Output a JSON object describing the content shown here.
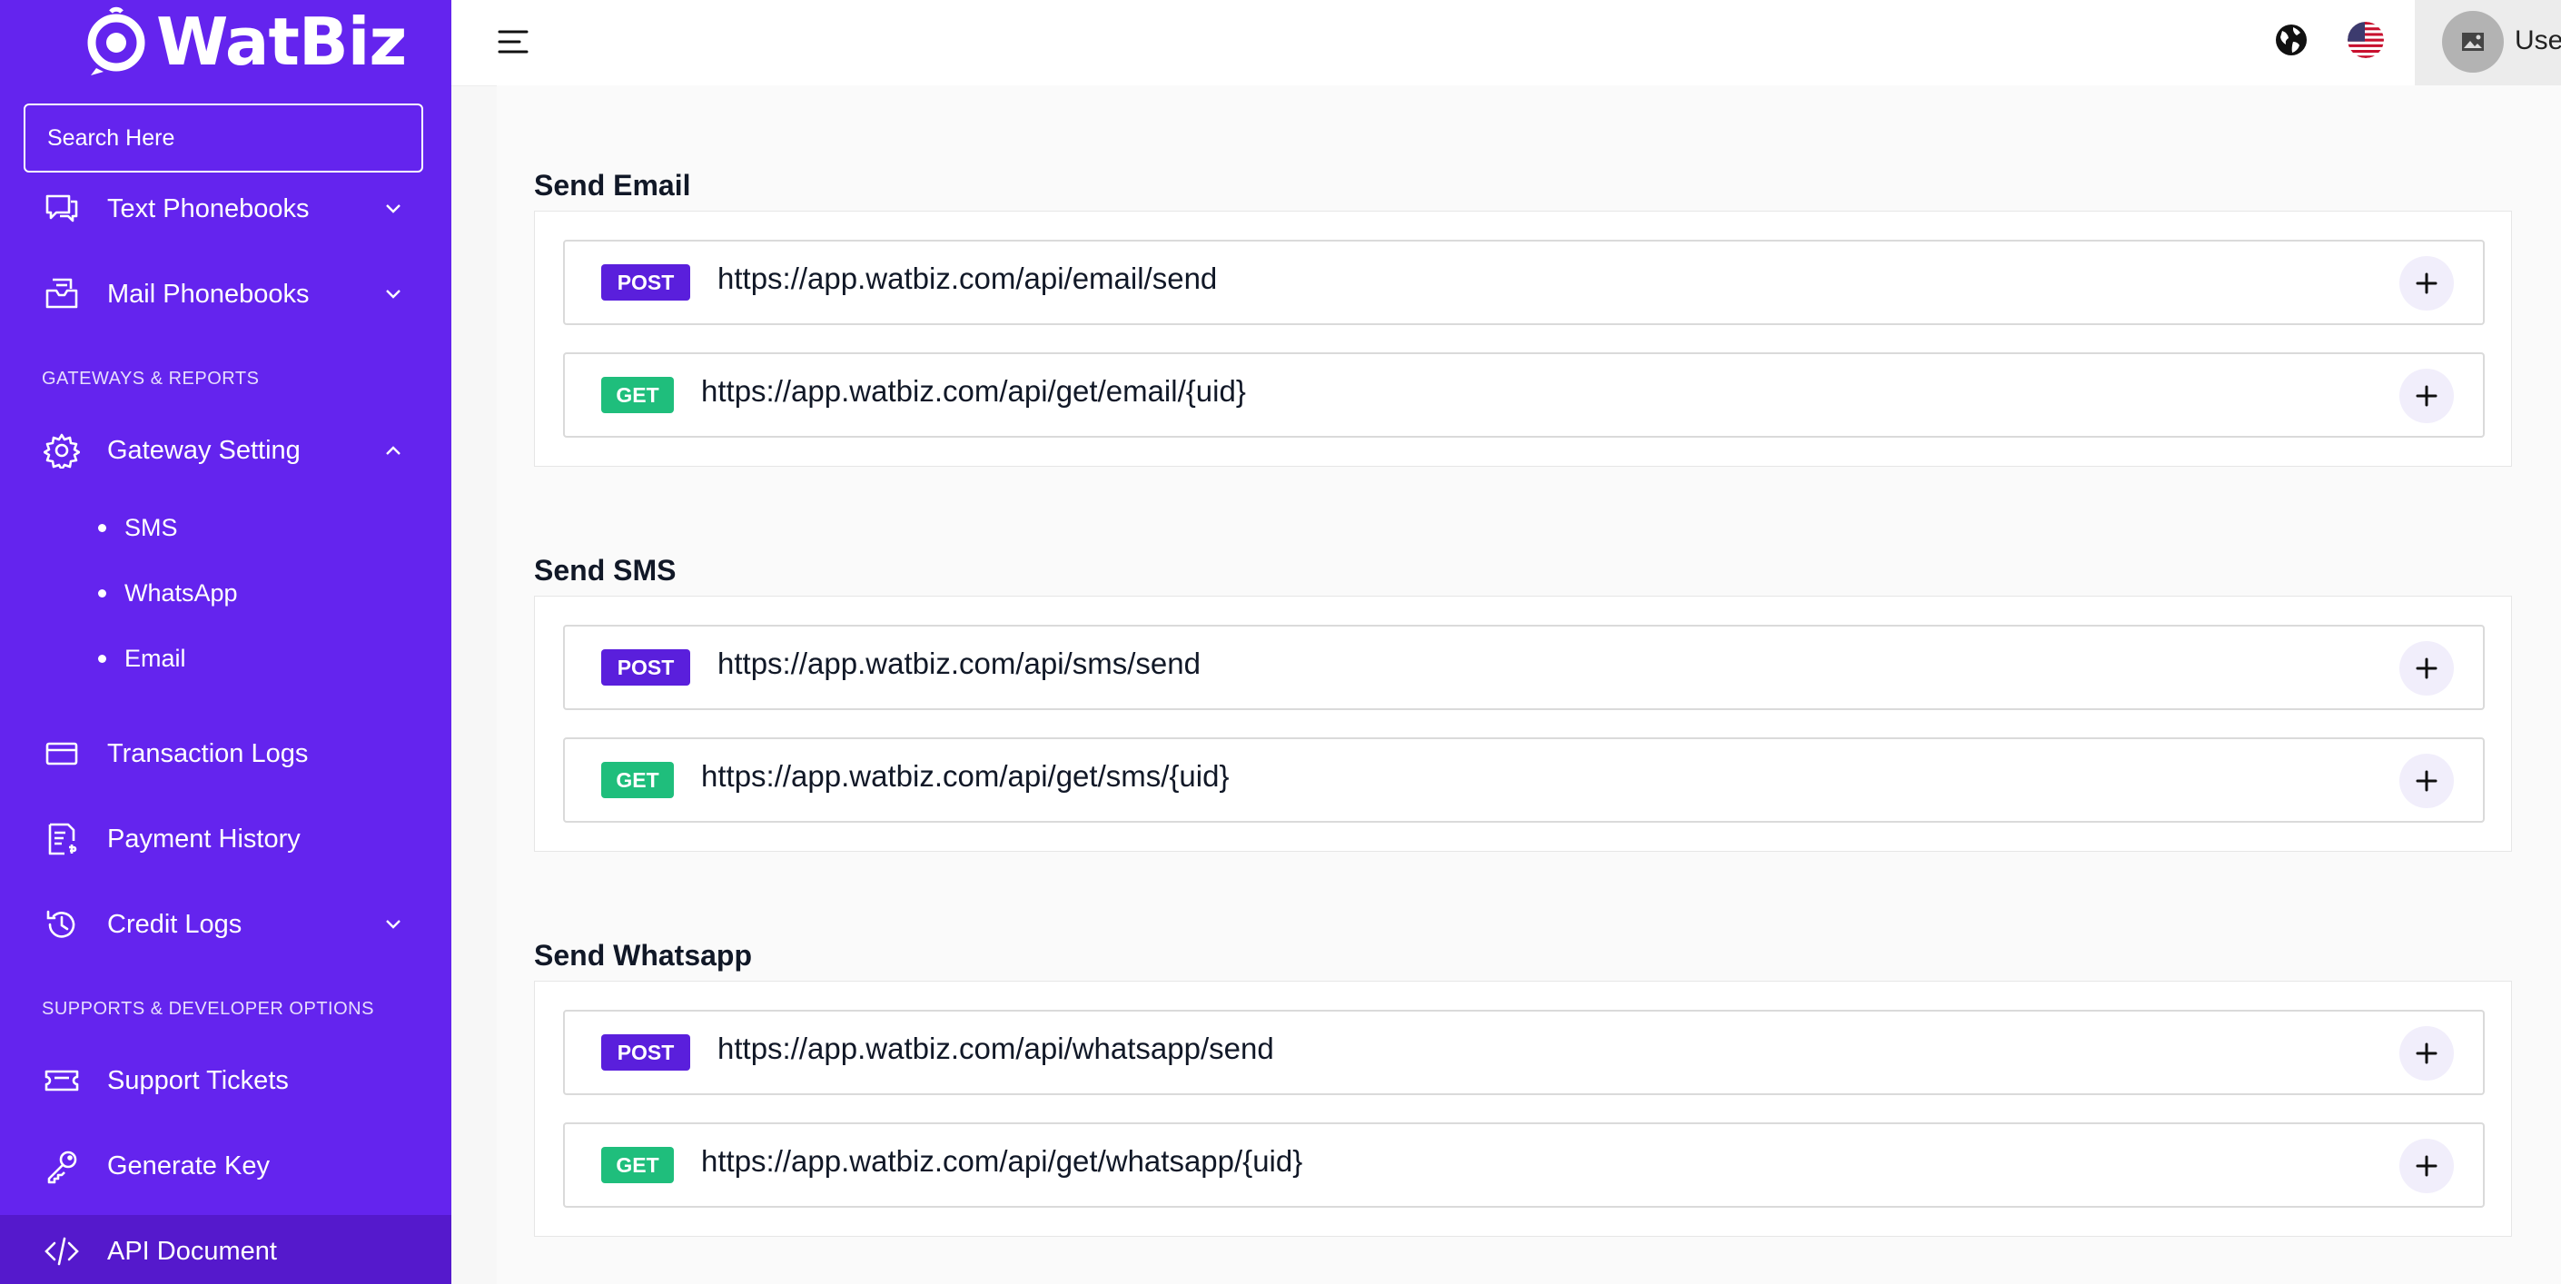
{
  "brand": {
    "name": "WatBiz",
    "sidebar_color": "#6424ee",
    "post_color": "#5a1fdc",
    "get_color": "#1fbe7c"
  },
  "search": {
    "placeholder": "Search Here"
  },
  "sidebar": {
    "items": [
      {
        "label": "Text Phonebooks",
        "icon": "chat-icon",
        "expand": "chevron-down"
      },
      {
        "label": "Mail Phonebooks",
        "icon": "inbox-icon",
        "expand": "chevron-down"
      }
    ],
    "section_gateways": "GATEWAYS & REPORTS",
    "gateway": {
      "label": "Gateway Setting",
      "icon": "gear-icon",
      "expand": "chevron-up"
    },
    "gateway_sub": [
      "SMS",
      "WhatsApp",
      "Email"
    ],
    "reports": [
      {
        "label": "Transaction Logs",
        "icon": "card-icon"
      },
      {
        "label": "Payment History",
        "icon": "receipt-icon"
      },
      {
        "label": "Credit Logs",
        "icon": "history-icon",
        "expand": "chevron-down"
      }
    ],
    "section_support": "SUPPORTS & DEVELOPER OPTIONS",
    "support": [
      {
        "label": "Support Tickets",
        "icon": "ticket-icon"
      },
      {
        "label": "Generate Key",
        "icon": "key-icon"
      },
      {
        "label": "API Document",
        "icon": "code-icon",
        "active": true
      }
    ]
  },
  "header": {
    "user_label": "Use"
  },
  "sections": [
    {
      "title": "Send Email",
      "endpoints": [
        {
          "method": "POST",
          "url": "https://app.watbiz.com/api/email/send"
        },
        {
          "method": "GET",
          "url": "https://app.watbiz.com/api/get/email/{uid}"
        }
      ]
    },
    {
      "title": "Send SMS",
      "endpoints": [
        {
          "method": "POST",
          "url": "https://app.watbiz.com/api/sms/send"
        },
        {
          "method": "GET",
          "url": "https://app.watbiz.com/api/get/sms/{uid}"
        }
      ]
    },
    {
      "title": "Send Whatsapp",
      "endpoints": [
        {
          "method": "POST",
          "url": "https://app.watbiz.com/api/whatsapp/send"
        },
        {
          "method": "GET",
          "url": "https://app.watbiz.com/api/get/whatsapp/{uid}"
        }
      ]
    }
  ]
}
